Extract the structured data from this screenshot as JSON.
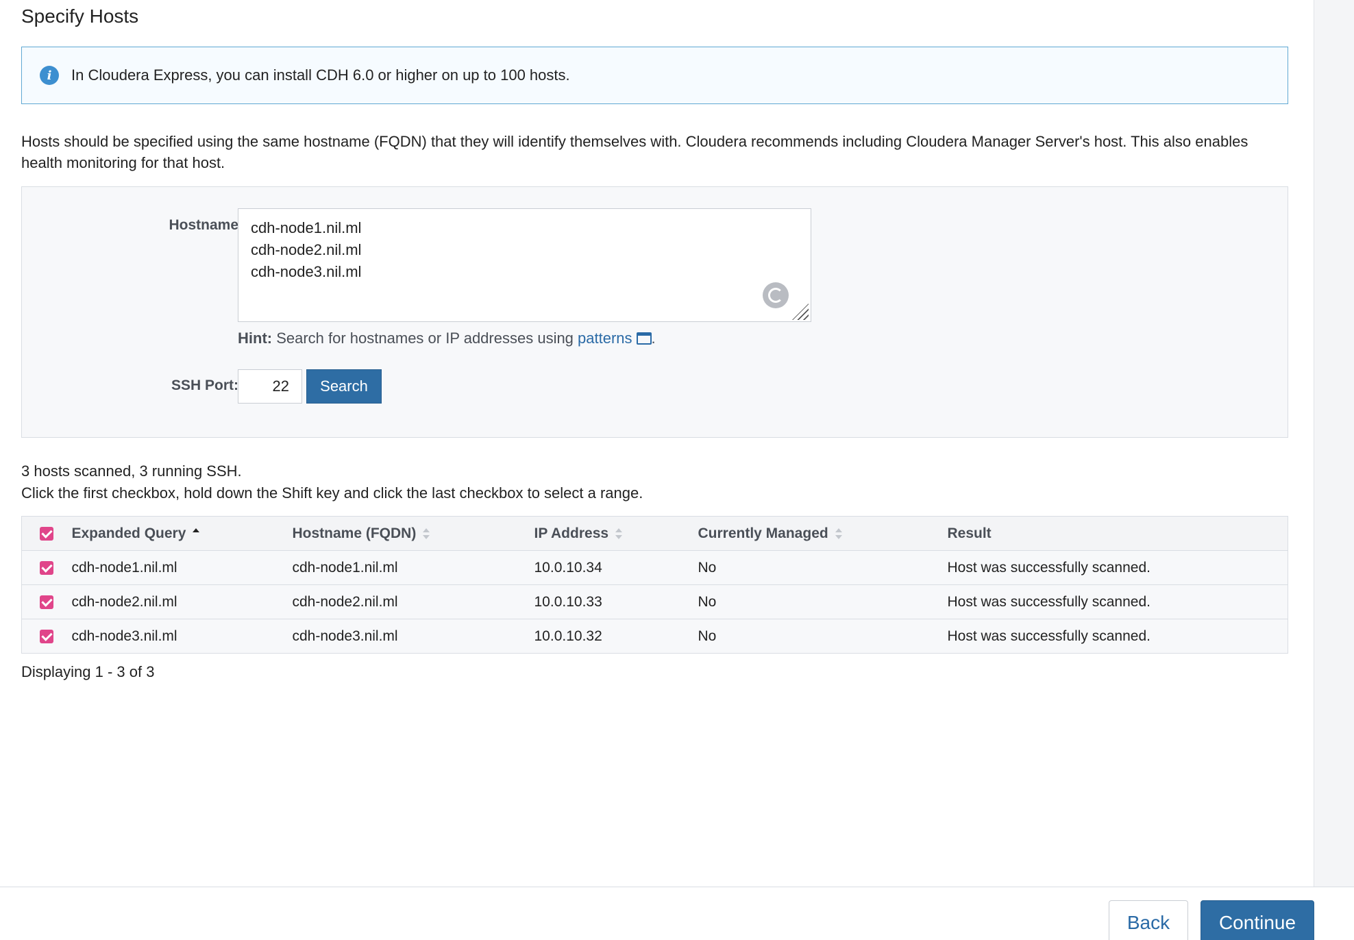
{
  "page": {
    "title": "Specify Hosts"
  },
  "alert": {
    "icon": "info-icon",
    "text": "In Cloudera Express, you can install CDH 6.0 or higher on up to 100 hosts."
  },
  "description": "Hosts should be specified using the same hostname (FQDN) that they will identify themselves with. Cloudera recommends including Cloudera Manager Server's host. This also enables health monitoring for that host.",
  "form": {
    "hostname_label": "Hostname",
    "hostname_value": "cdh-node1.nil.ml\ncdh-node2.nil.ml\ncdh-node3.nil.ml",
    "hint_bold": "Hint:",
    "hint_text": " Search for hostnames or IP addresses using ",
    "hint_link": "patterns",
    "hint_end": ".",
    "ssh_label": "SSH Port:",
    "ssh_value": "22",
    "search_label": "Search"
  },
  "scan": {
    "summary": "3 hosts scanned, 3 running SSH.",
    "instructions": "Click the first checkbox, hold down the Shift key and click the last checkbox to select a range."
  },
  "table": {
    "columns": {
      "expanded_query": "Expanded Query",
      "hostname": "Hostname (FQDN)",
      "ip": "IP Address",
      "managed": "Currently Managed",
      "result": "Result"
    },
    "rows": [
      {
        "query": "cdh-node1.nil.ml",
        "hostname": "cdh-node1.nil.ml",
        "ip": "10.0.10.34",
        "managed": "No",
        "result": "Host was successfully scanned.",
        "checked": true
      },
      {
        "query": "cdh-node2.nil.ml",
        "hostname": "cdh-node2.nil.ml",
        "ip": "10.0.10.33",
        "managed": "No",
        "result": "Host was successfully scanned.",
        "checked": true
      },
      {
        "query": "cdh-node3.nil.ml",
        "hostname": "cdh-node3.nil.ml",
        "ip": "10.0.10.32",
        "managed": "No",
        "result": "Host was successfully scanned.",
        "checked": true
      }
    ],
    "footer": "Displaying 1 - 3 of 3"
  },
  "footer": {
    "back_label": "Back",
    "continue_label": "Continue"
  },
  "colors": {
    "accent": "#2e6da4",
    "checkbox": "#e0458a",
    "info_border": "#5fa8d3"
  }
}
